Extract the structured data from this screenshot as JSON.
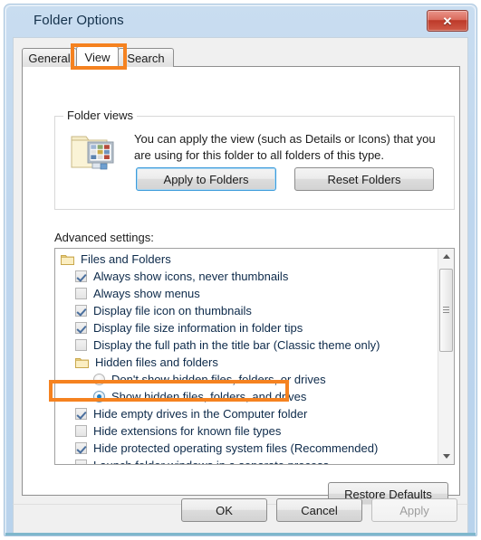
{
  "window": {
    "title": "Folder Options",
    "close_glyph": "✕",
    "accent_color": "#f58220"
  },
  "tabs": [
    {
      "label": "General",
      "selected": false
    },
    {
      "label": "View",
      "selected": true
    },
    {
      "label": "Search",
      "selected": false
    }
  ],
  "folder_views": {
    "legend": "Folder views",
    "description": "You can apply the view (such as Details or Icons) that you are using for this folder to all folders of this type.",
    "buttons": [
      {
        "label": "Apply to Folders",
        "focused": true
      },
      {
        "label": "Reset Folders",
        "focused": false
      }
    ]
  },
  "advanced": {
    "label": "Advanced settings:",
    "rows": [
      {
        "kind": "group",
        "label": "Files and Folders"
      },
      {
        "kind": "checkbox",
        "label": "Always show icons, never thumbnails",
        "checked": true
      },
      {
        "kind": "checkbox",
        "label": "Always show menus",
        "checked": false
      },
      {
        "kind": "checkbox",
        "label": "Display file icon on thumbnails",
        "checked": true
      },
      {
        "kind": "checkbox",
        "label": "Display file size information in folder tips",
        "checked": true
      },
      {
        "kind": "checkbox",
        "label": "Display the full path in the title bar (Classic theme only)",
        "checked": false
      },
      {
        "kind": "group",
        "label": "Hidden files and folders",
        "indent": "item"
      },
      {
        "kind": "radio",
        "label": "Don't show hidden files, folders, or drives",
        "checked": false
      },
      {
        "kind": "radio",
        "label": "Show hidden files, folders, and drives",
        "checked": true
      },
      {
        "kind": "checkbox",
        "label": "Hide empty drives in the Computer folder",
        "checked": true
      },
      {
        "kind": "checkbox",
        "label": "Hide extensions for known file types",
        "checked": false,
        "highlighted": true
      },
      {
        "kind": "checkbox",
        "label": "Hide protected operating system files (Recommended)",
        "checked": true
      },
      {
        "kind": "checkbox",
        "label": "Launch folder windows in a separate process",
        "checked": false
      }
    ],
    "scrollbar": {
      "up_glyph": "▲",
      "down_glyph": "▼"
    }
  },
  "restore_defaults": {
    "label": "Restore Defaults"
  },
  "footer_buttons": [
    {
      "label": "OK",
      "enabled": true
    },
    {
      "label": "Cancel",
      "enabled": true
    },
    {
      "label": "Apply",
      "enabled": false
    }
  ]
}
